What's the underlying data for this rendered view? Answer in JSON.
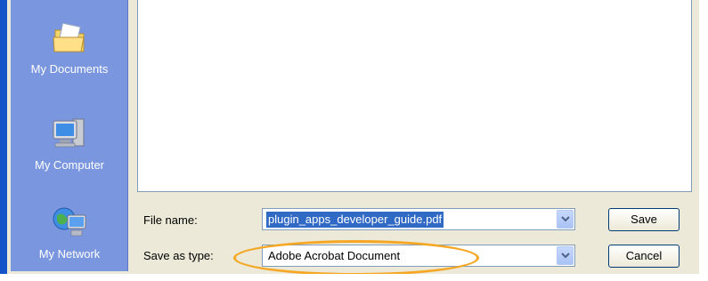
{
  "places": [
    {
      "id": "my-documents",
      "label": "My Documents",
      "icon": "my-documents-icon"
    },
    {
      "id": "my-computer",
      "label": "My Computer",
      "icon": "my-computer-icon"
    },
    {
      "id": "my-network",
      "label": "My Network",
      "icon": "my-network-icon"
    }
  ],
  "form": {
    "file_name_label": "File name:",
    "file_name_value": "plugin_apps_developer_guide.pdf",
    "save_type_label": "Save as type:",
    "save_type_value": "Adobe Acrobat Document"
  },
  "buttons": {
    "save": "Save",
    "cancel": "Cancel"
  },
  "colors": {
    "places_bar": "#7a96df",
    "selection": "#316ac5",
    "highlight": "#f5a623"
  }
}
